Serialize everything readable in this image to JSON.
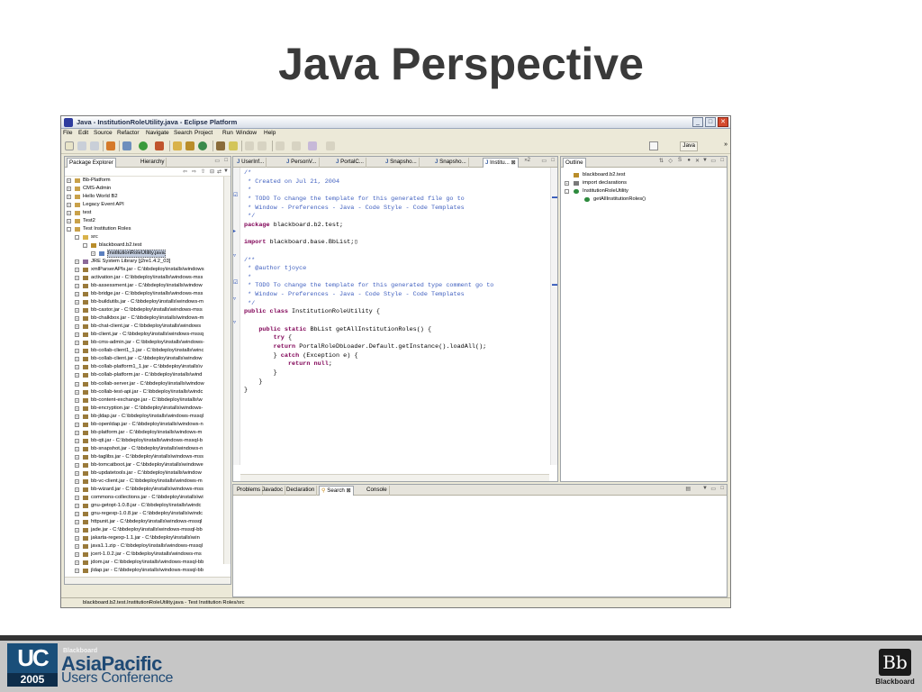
{
  "slide": {
    "title": "Java Perspective"
  },
  "window": {
    "title": "Java - InstitutionRoleUtility.java - Eclipse Platform",
    "controls": {
      "minimize": "_",
      "maximize": "□",
      "close": "✕"
    }
  },
  "menu": [
    "File",
    "Edit",
    "Source",
    "Refactor",
    "Navigate",
    "Search",
    "Project",
    "Run",
    "Window",
    "Help"
  ],
  "toolbar": {
    "perspective_label": "Java",
    "overflow": "»"
  },
  "package_explorer": {
    "tabs": [
      "Package Explorer",
      "Hierarchy"
    ],
    "tree": [
      {
        "label": "Bb-Platform",
        "depth": 0,
        "toggle": "+",
        "icon": "project"
      },
      {
        "label": "CMS-Admin",
        "depth": 0,
        "toggle": "+",
        "icon": "project"
      },
      {
        "label": "Hello World B2",
        "depth": 0,
        "toggle": "+",
        "icon": "project"
      },
      {
        "label": "Legacy Event API",
        "depth": 0,
        "toggle": "+",
        "icon": "project"
      },
      {
        "label": "test",
        "depth": 0,
        "toggle": "+",
        "icon": "project"
      },
      {
        "label": "Test2",
        "depth": 0,
        "toggle": "+",
        "icon": "project"
      },
      {
        "label": "Test Institution Roles",
        "depth": 0,
        "toggle": "-",
        "icon": "project"
      },
      {
        "label": "src",
        "depth": 1,
        "toggle": "-",
        "icon": "folder"
      },
      {
        "label": "blackboard.b2.test",
        "depth": 2,
        "toggle": "-",
        "icon": "package"
      },
      {
        "label": "InstitutionRoleUtility.java",
        "depth": 3,
        "toggle": "+",
        "icon": "java",
        "selected": true
      },
      {
        "label": "JRE System Library [j2re1.4.2_03]",
        "depth": 1,
        "toggle": "+",
        "icon": "library"
      },
      {
        "label": "xmlParserAPIs.jar - C:\\bbdeploy\\installs\\windows",
        "depth": 1,
        "toggle": "+",
        "icon": "jar"
      },
      {
        "label": "activation.jar - C:\\bbdeploy\\installs\\windows-mss",
        "depth": 1,
        "toggle": "+",
        "icon": "jar"
      },
      {
        "label": "bb-assessment.jar - C:\\bbdeploy\\installs\\window",
        "depth": 1,
        "toggle": "+",
        "icon": "jar"
      },
      {
        "label": "bb-bridge.jar - C:\\bbdeploy\\installs\\windows-mss",
        "depth": 1,
        "toggle": "+",
        "icon": "jar"
      },
      {
        "label": "bb-buildutils.jar - C:\\bbdeploy\\installs\\windows-m",
        "depth": 1,
        "toggle": "+",
        "icon": "jar"
      },
      {
        "label": "bb-castor.jar - C:\\bbdeploy\\installs\\windows-mss",
        "depth": 1,
        "toggle": "+",
        "icon": "jar"
      },
      {
        "label": "bb-chalkbox.jar - C:\\bbdeploy\\installs\\windows-m",
        "depth": 1,
        "toggle": "+",
        "icon": "jar"
      },
      {
        "label": "bb-chat-client.jar - C:\\bbdeploy\\installs\\windows",
        "depth": 1,
        "toggle": "+",
        "icon": "jar"
      },
      {
        "label": "bb-client.jar - C:\\bbdeploy\\installs\\windows-mssq",
        "depth": 1,
        "toggle": "+",
        "icon": "jar"
      },
      {
        "label": "bb-cms-admin.jar - C:\\bbdeploy\\installs\\windows-",
        "depth": 1,
        "toggle": "+",
        "icon": "jar"
      },
      {
        "label": "bb-collab-client1_1.jar - C:\\bbdeploy\\installs\\winc",
        "depth": 1,
        "toggle": "+",
        "icon": "jar"
      },
      {
        "label": "bb-collab-client.jar - C:\\bbdeploy\\installs\\window",
        "depth": 1,
        "toggle": "+",
        "icon": "jar"
      },
      {
        "label": "bb-collab-platform1_1.jar - C:\\bbdeploy\\installs\\v",
        "depth": 1,
        "toggle": "+",
        "icon": "jar"
      },
      {
        "label": "bb-collab-platform.jar - C:\\bbdeploy\\installs\\wind",
        "depth": 1,
        "toggle": "+",
        "icon": "jar"
      },
      {
        "label": "bb-collab-server.jar - C:\\bbdeploy\\installs\\window",
        "depth": 1,
        "toggle": "+",
        "icon": "jar"
      },
      {
        "label": "bb-collab-test-api.jar - C:\\bbdeploy\\installs\\windc",
        "depth": 1,
        "toggle": "+",
        "icon": "jar"
      },
      {
        "label": "bb-content-exchange.jar - C:\\bbdeploy\\installs\\w",
        "depth": 1,
        "toggle": "+",
        "icon": "jar"
      },
      {
        "label": "bb-encryption.jar - C:\\bbdeploy\\installs\\windows-",
        "depth": 1,
        "toggle": "+",
        "icon": "jar"
      },
      {
        "label": "bb-jldap.jar - C:\\bbdeploy\\installs\\windows-mssql",
        "depth": 1,
        "toggle": "+",
        "icon": "jar"
      },
      {
        "label": "bb-openldap.jar - C:\\bbdeploy\\installs\\windows-n",
        "depth": 1,
        "toggle": "+",
        "icon": "jar"
      },
      {
        "label": "bb-platform.jar - C:\\bbdeploy\\installs\\windows-m",
        "depth": 1,
        "toggle": "+",
        "icon": "jar"
      },
      {
        "label": "bb-qti.jar - C:\\bbdeploy\\installs\\windows-mssql-b",
        "depth": 1,
        "toggle": "+",
        "icon": "jar"
      },
      {
        "label": "bb-snapshot.jar - C:\\bbdeploy\\installs\\windows-n",
        "depth": 1,
        "toggle": "+",
        "icon": "jar"
      },
      {
        "label": "bb-taglibs.jar - C:\\bbdeploy\\installs\\windows-mss",
        "depth": 1,
        "toggle": "+",
        "icon": "jar"
      },
      {
        "label": "bb-tomcatboot.jar - C:\\bbdeploy\\installs\\windowe",
        "depth": 1,
        "toggle": "+",
        "icon": "jar"
      },
      {
        "label": "bb-updatetools.jar - C:\\bbdeploy\\installs\\window",
        "depth": 1,
        "toggle": "+",
        "icon": "jar"
      },
      {
        "label": "bb-vc-client.jar - C:\\bbdeploy\\installs\\windows-m",
        "depth": 1,
        "toggle": "+",
        "icon": "jar"
      },
      {
        "label": "bb-wizard.jar - C:\\bbdeploy\\installs\\windows-mss",
        "depth": 1,
        "toggle": "+",
        "icon": "jar"
      },
      {
        "label": "commons-collections.jar - C:\\bbdeploy\\installs\\wi",
        "depth": 1,
        "toggle": "+",
        "icon": "jar"
      },
      {
        "label": "gnu-getopt-1.0.8.jar - C:\\bbdeploy\\installs\\windc",
        "depth": 1,
        "toggle": "+",
        "icon": "jar"
      },
      {
        "label": "gnu-regexp-1.0.8.jar - C:\\bbdeploy\\installs\\windc",
        "depth": 1,
        "toggle": "+",
        "icon": "jar"
      },
      {
        "label": "httpunit.jar - C:\\bbdeploy\\installs\\windows-mssql",
        "depth": 1,
        "toggle": "+",
        "icon": "jar"
      },
      {
        "label": "jade.jar - C:\\bbdeploy\\installs\\windows-mssql-bb",
        "depth": 1,
        "toggle": "+",
        "icon": "jar"
      },
      {
        "label": "jakarta-regexp-1.1.jar - C:\\bbdeploy\\installs\\win",
        "depth": 1,
        "toggle": "+",
        "icon": "jar"
      },
      {
        "label": "java1.1.zip - C:\\bbdeploy\\installs\\windows-mssql",
        "depth": 1,
        "toggle": "+",
        "icon": "jar"
      },
      {
        "label": "jcert-1.0.2.jar - C:\\bbdeploy\\installs\\windows-ms",
        "depth": 1,
        "toggle": "+",
        "icon": "jar"
      },
      {
        "label": "jdom.jar - C:\\bbdeploy\\installs\\windows-mssql-bb",
        "depth": 1,
        "toggle": "+",
        "icon": "jar"
      },
      {
        "label": "jldap.jar - C:\\bbdeploy\\installs\\windows-mssql-bb",
        "depth": 1,
        "toggle": "+",
        "icon": "jar"
      }
    ]
  },
  "editor": {
    "tabs": [
      "UserInf...",
      "PersonV...",
      "PortalC...",
      "Snapsho...",
      "Snapsho...",
      "Institu..."
    ],
    "overflow_count": "»2",
    "lines": [
      [
        {
          "t": "/*",
          "c": "cmt"
        }
      ],
      [
        {
          "t": " * Created on Jul 21, 2004",
          "c": "cmt"
        }
      ],
      [
        {
          "t": " *",
          "c": "cmt"
        }
      ],
      [
        {
          "t": " * TODO To change the template for this generated file go to",
          "c": "cmt"
        }
      ],
      [
        {
          "t": " * Window - Preferences - Java - Code Style - Code Templates",
          "c": "cmt"
        }
      ],
      [
        {
          "t": " */",
          "c": "cmt"
        }
      ],
      [
        {
          "t": "package",
          "c": "kw"
        },
        {
          "t": " blackboard.b2.test;",
          "c": "txt"
        }
      ],
      [
        {
          "t": "",
          "c": "txt"
        }
      ],
      [
        {
          "t": "import",
          "c": "kw"
        },
        {
          "t": " blackboard.base.BbList;",
          "c": "txt"
        },
        {
          "t": "▯",
          "c": "txt"
        }
      ],
      [
        {
          "t": "",
          "c": "txt"
        }
      ],
      [
        {
          "t": "/**",
          "c": "cmt"
        }
      ],
      [
        {
          "t": " * @author tjoyce",
          "c": "cmt"
        }
      ],
      [
        {
          "t": " *",
          "c": "cmt"
        }
      ],
      [
        {
          "t": " * TODO To change the template for this generated type comment go to",
          "c": "cmt"
        }
      ],
      [
        {
          "t": " * Window - Preferences - Java - Code Style - Code Templates",
          "c": "cmt"
        }
      ],
      [
        {
          "t": " */",
          "c": "cmt"
        }
      ],
      [
        {
          "t": "public class",
          "c": "kw"
        },
        {
          "t": " InstitutionRoleUtility {",
          "c": "txt"
        }
      ],
      [
        {
          "t": "",
          "c": "txt"
        }
      ],
      [
        {
          "t": "    ",
          "c": "txt"
        },
        {
          "t": "public static",
          "c": "kw"
        },
        {
          "t": " BbList getAllInstitutionRoles() {",
          "c": "txt"
        }
      ],
      [
        {
          "t": "        ",
          "c": "txt"
        },
        {
          "t": "try",
          "c": "kw"
        },
        {
          "t": " {",
          "c": "txt"
        }
      ],
      [
        {
          "t": "        ",
          "c": "txt"
        },
        {
          "t": "return",
          "c": "kw"
        },
        {
          "t": " PortalRoleDbLoader.Default.getInstance().loadAll();",
          "c": "txt"
        }
      ],
      [
        {
          "t": "        } ",
          "c": "txt"
        },
        {
          "t": "catch",
          "c": "kw"
        },
        {
          "t": " (Exception e) {",
          "c": "txt"
        }
      ],
      [
        {
          "t": "            ",
          "c": "txt"
        },
        {
          "t": "return null",
          "c": "kw"
        },
        {
          "t": ";",
          "c": "txt"
        }
      ],
      [
        {
          "t": "        }",
          "c": "txt"
        }
      ],
      [
        {
          "t": "    }",
          "c": "txt"
        }
      ],
      [
        {
          "t": "}",
          "c": "txt"
        }
      ]
    ]
  },
  "outline": {
    "tab": "Outline",
    "items": [
      {
        "label": "blackboard.b2.test",
        "depth": 0,
        "icon": "package"
      },
      {
        "label": "import declarations",
        "depth": 0,
        "icon": "imports",
        "toggle": "+"
      },
      {
        "label": "InstitutionRoleUtility",
        "depth": 0,
        "icon": "class",
        "toggle": "-"
      },
      {
        "label": "getAllInstitutionRoles()",
        "depth": 1,
        "icon": "method"
      }
    ]
  },
  "bottom": {
    "tabs": [
      "Problems",
      "Javadoc",
      "Declaration",
      "Search",
      "Console"
    ]
  },
  "status": {
    "text": "blackboard.b2.test.InstitutionRoleUtility.java - Test Institution Roles/src"
  },
  "footer": {
    "uc_mark": "UC",
    "uc_year": "2005",
    "brand_small": "Blackboard",
    "brand_line1": "AsiaPacific",
    "brand_line2": "Users Conference",
    "bb_mark": "Bb",
    "bb_word": "Blackboard"
  },
  "colors": {
    "comment": "#3f5fbf",
    "keyword": "#7f0055",
    "brand": "#1f4a75"
  }
}
